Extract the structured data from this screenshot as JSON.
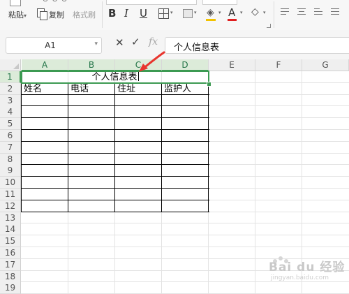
{
  "toolbar": {
    "paste_label": "粘贴",
    "paste_dropdown": "▾",
    "copy_label": "复制",
    "format_painter_label": "格式刷",
    "top_small": "- ⊙ ⊙ ⊙",
    "bold": "B",
    "italic": "I",
    "underline": "U",
    "font_color_glyph": "A",
    "fill_glyph": "◈",
    "eraser_glyph": "◇",
    "dropdown_glyph": "▾",
    "accent_colors": {
      "fill": "#f2c200",
      "font": "#e02020"
    }
  },
  "formula_bar": {
    "name_box": "A1",
    "cancel_glyph": "✕",
    "confirm_glyph": "✓",
    "fx_label": "fx",
    "content": "个人信息表"
  },
  "grid": {
    "columns": [
      "A",
      "B",
      "C",
      "D",
      "E",
      "F",
      "G"
    ],
    "selected_columns": [
      "A",
      "B",
      "C",
      "D"
    ],
    "rows": [
      "1",
      "2",
      "3",
      "4",
      "5",
      "6",
      "7",
      "8",
      "9",
      "10",
      "11",
      "12",
      "13",
      "14",
      "15",
      "16",
      "17",
      "18",
      "19"
    ],
    "selected_row": "1",
    "selection_color": "#3c9a52"
  },
  "sheet": {
    "title_cell": "个人信息表",
    "headers": [
      "姓名",
      "电话",
      "住址",
      "监护人"
    ]
  },
  "watermark": {
    "text": "Bai du 经验",
    "sub": "jingyan.baidu.com"
  }
}
